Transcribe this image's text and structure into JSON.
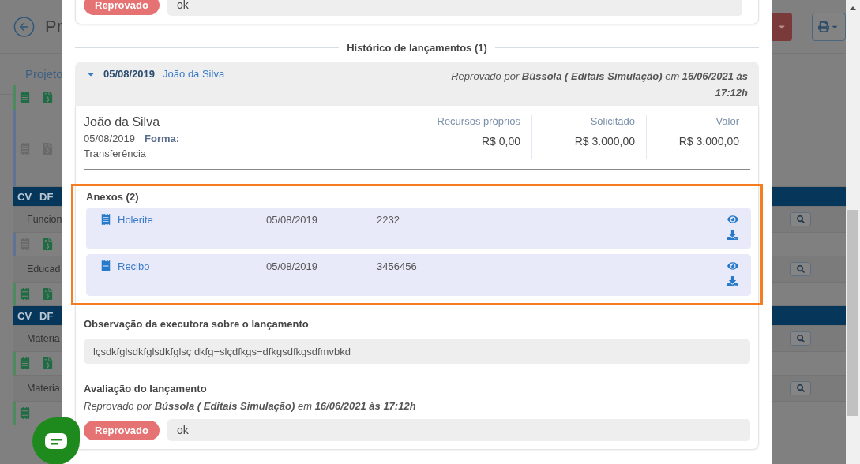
{
  "background": {
    "title": "Pr",
    "tab": "Projeto",
    "rows": [
      {
        "kind": "icons",
        "icons": [
          {
            "kind": "receipt",
            "active": true
          },
          {
            "kind": "dollar",
            "active": true
          }
        ]
      },
      {
        "kind": "icons",
        "tall": true,
        "icons": [
          {
            "kind": "receipt",
            "active": false
          },
          {
            "kind": "dollar",
            "active": false
          }
        ]
      },
      {
        "kind": "band",
        "codes": [
          "CV",
          "DF"
        ]
      },
      {
        "kind": "label",
        "label": "Funcion"
      },
      {
        "kind": "icons",
        "icons": [
          {
            "kind": "receipt",
            "active": false
          },
          {
            "kind": "dollar",
            "active": true
          }
        ]
      },
      {
        "kind": "label",
        "label": "Educad"
      },
      {
        "kind": "icons",
        "icons": [
          {
            "kind": "receipt",
            "active": true
          },
          {
            "kind": "dollar",
            "active": true
          }
        ]
      },
      {
        "kind": "band",
        "codes": [
          "CV",
          "DF"
        ]
      },
      {
        "kind": "label",
        "label": "Materia"
      },
      {
        "kind": "icons",
        "icons": [
          {
            "kind": "receipt",
            "active": true
          },
          {
            "kind": "dollar",
            "active": true
          }
        ]
      },
      {
        "kind": "label",
        "label": "Materia"
      },
      {
        "kind": "icons",
        "icons": [
          {
            "kind": "receipt",
            "active": true
          }
        ]
      }
    ]
  },
  "modal": {
    "top_evaluation": {
      "status": "Reprovado",
      "kind": "rejected",
      "comment": "ok"
    },
    "history_title": "Histórico de lançamentos (1)",
    "entry": {
      "expanded": true,
      "date": "05/08/2019",
      "name": "João da Silva",
      "status_note": "Reprovado por **Bússola ( Editais Simulação)** em **16/06/2021 às 17:12h**",
      "payee": "João da Silva",
      "payment_date": "05/08/2019",
      "form_label": "Forma:",
      "form_value": "Transferência",
      "amounts": [
        {
          "label": "Recursos próprios",
          "value": "R$ 0,00"
        },
        {
          "label": "Solicitado",
          "value": "R$ 3.000,00"
        },
        {
          "label": "Valor",
          "value": "R$ 3.000,00"
        }
      ],
      "attachments_title": "Anexos (2)",
      "attachments": [
        {
          "name": "Holerite",
          "date": "05/08/2019",
          "number": "2232"
        },
        {
          "name": "Recibo",
          "date": "05/08/2019",
          "number": "3456456"
        }
      ],
      "observation_title": "Observação da executora sobre o lançamento",
      "observation": "lçsdkfglsdkfglsdkfglsç dkfg−slçdfkgs−dfkgsdfkgsdfmvbkd",
      "evaluation_title": "Avaliação do lançamento",
      "evaluation_note": "Reprovado por **Bússola ( Editais Simulação)** em **16/06/2021 às 17:12h**",
      "evaluation": {
        "status": "Reprovado",
        "kind": "rejected",
        "comment": "ok"
      }
    }
  }
}
